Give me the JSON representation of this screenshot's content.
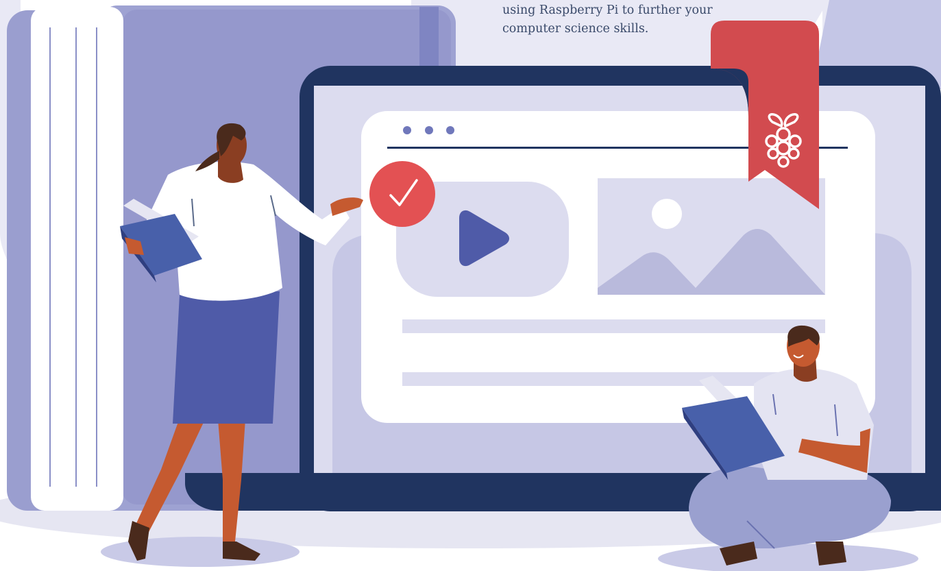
{
  "hero": {
    "caption_lines": [
      "using Raspberry Pi to further your",
      "computer science skills."
    ]
  },
  "illustration": {
    "colors": {
      "background_blob": "#e9e9f5",
      "book_spine": "#9a9ecf",
      "laptop_frame": "#203460",
      "screen": "#dcdcef",
      "window": "#ffffff",
      "accent_red": "#e35153",
      "ribbon": "#d24b4f",
      "play_icon": "#4f5ba8",
      "skin": "#c55a30",
      "book_blue": "#4860aa"
    },
    "icons": [
      "play-icon",
      "checkmark-icon",
      "raspberry-pi-logo",
      "image-placeholder-icon",
      "browser-dots-icon"
    ]
  }
}
